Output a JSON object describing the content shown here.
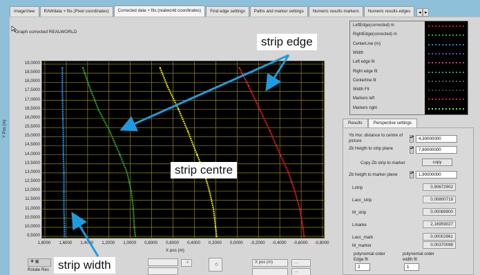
{
  "tabs": [
    "ImageView",
    "RAWdata + fits (Pixel coordinates)",
    "Corrected data + fits (realworld coordinates)",
    "Find edge settings",
    "Paths and marker settings",
    "Numeric results markers",
    "Numeric results edges"
  ],
  "active_tab_index": 2,
  "graph": {
    "title": "Graph corrected REALWORLD",
    "y_label": "Y Pos (m)",
    "x_label": "X pos (m)",
    "y_ticks": [
      "19,0000",
      "18,5000",
      "18,0000",
      "17,5000",
      "17,0000",
      "16,5000",
      "16,0000",
      "15,5000",
      "15,0000",
      "14,5000",
      "14,0000",
      "13,5000",
      "13,0000",
      "12,5000",
      "12,0000",
      "11,5000",
      "11,0000",
      "10,5000",
      "10,0000",
      "9,5000"
    ],
    "x_ticks": [
      "1,8000",
      "1,6000",
      "1,4000",
      "1,2000",
      "1,0000",
      "0,8000",
      "0,6000",
      "0,4000",
      "0,2000",
      "0,0000",
      "-0,2000",
      "-0,4000",
      "-0,6000",
      "-0,8000"
    ]
  },
  "legend": [
    {
      "label": "LeftEdge(corrected) m",
      "color": "#d81818"
    },
    {
      "label": "RightEdge(corrected) m",
      "color": "#3fa33f"
    },
    {
      "label": "CenterLine (m)",
      "color": "#2f82c8"
    },
    {
      "label": "Width",
      "color": "#7d3fd0"
    },
    {
      "label": "Left edge fit",
      "color": "#c83c8c"
    },
    {
      "label": "Right edge fit",
      "color": "#2f9c8f"
    },
    {
      "label": "Centerline fit",
      "color": "#5a5a5a"
    },
    {
      "label": "Width Fit",
      "color": "#404040"
    },
    {
      "label": "Markers left",
      "color": "#e02020"
    },
    {
      "label": "Markers right",
      "color": "#8fe05a"
    }
  ],
  "settings_tabs": [
    "Results",
    "Perspective settings"
  ],
  "active_settings_tab": 1,
  "settings": {
    "yb_label": "Yb Hor. distance to centre of picture",
    "yb_value": "4,30000000",
    "zb_strip_label": "Zb Heigth to strip plane",
    "zb_strip_value": "7,80000000",
    "copy_label": "Copy Zb strip to marker",
    "copy_button": "copy",
    "zb_marker_label": "Zb heigth to marker plane",
    "zb_marker_value": "1,90000000",
    "results": [
      {
        "label": "Lstrip",
        "value": "0,90672902"
      },
      {
        "label": "Lacc_strip",
        "value": "0,00800719"
      },
      {
        "label": "M_strip",
        "value": "0,00089900"
      },
      {
        "label": "Lmarke",
        "value": "2,16959027"
      },
      {
        "label": "Lacc_mark",
        "value": "0,00002961"
      },
      {
        "label": "M_marker",
        "value": "0,00370098"
      }
    ],
    "poly_edge_label": "polynomial order Edge fit",
    "poly_edge_value": "2",
    "poly_width_label": "polynomial order width fit",
    "poly_width_value": "1"
  },
  "toolbar": {
    "rotate_label": "Rotate Res",
    "xpos_select": "X pos (m)"
  },
  "annotations": {
    "strip_edge": "strip edge",
    "strip_centre": "strip centre",
    "strip_width": "strip width"
  },
  "chart_data": {
    "type": "line",
    "xlabel": "X pos (m)",
    "ylabel": "Y Pos (m)",
    "xlim": [
      1.85,
      -0.85
    ],
    "ylim": [
      9.5,
      19.0
    ],
    "grid": true,
    "series": [
      {
        "name": "CenterLine (m)",
        "color": "#1e90ff",
        "x": [
          1.68,
          1.68,
          1.675,
          1.67,
          1.67,
          1.665,
          1.665,
          1.665,
          1.66,
          1.66
        ],
        "y": [
          18.8,
          17.5,
          16.0,
          15.0,
          14.0,
          13.0,
          12.0,
          11.0,
          10.0,
          9.5
        ]
      },
      {
        "name": "RightEdge(corrected) m",
        "color": "#2fa52f",
        "x": [
          1.48,
          1.42,
          1.33,
          1.22,
          1.12,
          1.05,
          1.01,
          0.99,
          0.98,
          0.97
        ],
        "y": [
          18.8,
          17.8,
          16.5,
          15.3,
          14.0,
          13.0,
          12.0,
          11.0,
          10.0,
          9.5
        ]
      },
      {
        "name": "Center",
        "color": "#e6e600",
        "x": [
          0.73,
          0.66,
          0.55,
          0.46,
          0.37,
          0.3,
          0.25,
          0.21,
          0.19,
          0.18
        ],
        "y": [
          18.8,
          17.8,
          16.5,
          15.3,
          14.0,
          13.0,
          12.0,
          11.0,
          10.0,
          9.5
        ]
      },
      {
        "name": "LeftEdge(corrected) m",
        "color": "#e02020",
        "x": [
          -0.04,
          -0.13,
          -0.24,
          -0.34,
          -0.44,
          -0.52,
          -0.58,
          -0.63,
          -0.66,
          -0.67
        ],
        "y": [
          18.8,
          17.8,
          16.5,
          15.3,
          14.0,
          13.0,
          12.0,
          11.0,
          10.0,
          9.5
        ]
      }
    ]
  }
}
